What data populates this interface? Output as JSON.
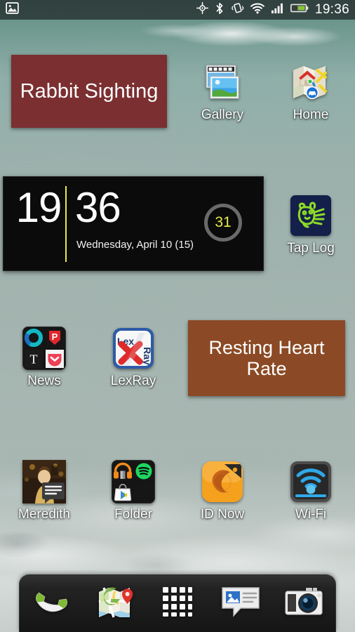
{
  "status_bar": {
    "time": "19:36",
    "left_icons": [
      {
        "name": "image-notification-icon",
        "glyph": "photo"
      }
    ],
    "right_icons": [
      {
        "name": "gps-icon",
        "label": "GPS"
      },
      {
        "name": "bluetooth-icon",
        "label": "Bluetooth"
      },
      {
        "name": "vibrate-icon",
        "label": "Vibrate"
      },
      {
        "name": "wifi-icon",
        "label": "Wi-Fi"
      },
      {
        "name": "cell-signal-icon",
        "label": "Signal"
      },
      {
        "name": "battery-icon",
        "label": "Battery"
      }
    ]
  },
  "widgets": {
    "rabbit_sighting": {
      "label": "Rabbit Sighting",
      "color": "#7b2f31",
      "text_color": "#ffffff"
    },
    "resting_heart_rate": {
      "label": "Resting Heart Rate",
      "color": "#8b4a25",
      "text_color": "#ffffff"
    },
    "clock": {
      "hour": "19",
      "minute": "36",
      "date": "Wednesday, April 10 (15)",
      "badge": "31",
      "divider_color": "#e8ed4a",
      "badge_color": "#e6e84c",
      "background": "#0b0b0b"
    }
  },
  "apps": [
    {
      "name": "gallery",
      "label": "Gallery",
      "icon": "gallery-icon"
    },
    {
      "name": "home",
      "label": "Home",
      "icon": "home-map-icon"
    },
    {
      "name": "tap-log",
      "label": "Tap Log",
      "icon": "tap-log-icon"
    },
    {
      "name": "news",
      "label": "News",
      "icon": "news-folder-icon"
    },
    {
      "name": "lexray",
      "label": "LexRay",
      "icon": "lexray-icon"
    },
    {
      "name": "meredith",
      "label": "Meredith",
      "icon": "contact-photo-icon"
    },
    {
      "name": "folder",
      "label": "Folder",
      "icon": "media-folder-icon"
    },
    {
      "name": "id-now",
      "label": "ID Now",
      "icon": "id-now-icon"
    },
    {
      "name": "wifi",
      "label": "Wi-Fi",
      "icon": "wifi-toggle-icon"
    }
  ],
  "dock": [
    {
      "name": "phone",
      "label": "Phone",
      "icon": "phone-icon"
    },
    {
      "name": "maps",
      "label": "Maps",
      "icon": "maps-icon"
    },
    {
      "name": "app-drawer",
      "label": "Apps",
      "icon": "app-drawer-icon"
    },
    {
      "name": "messaging",
      "label": "Messaging",
      "icon": "messaging-icon"
    },
    {
      "name": "camera",
      "label": "Camera",
      "icon": "camera-icon"
    }
  ]
}
